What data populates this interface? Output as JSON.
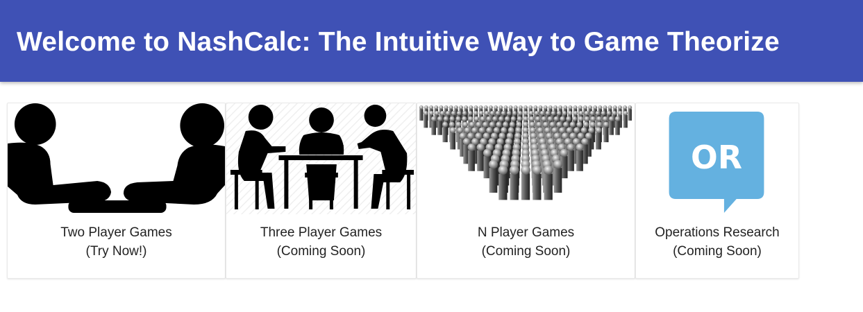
{
  "header": {
    "title": "Welcome to NashCalc: The Intuitive Way to Game Theorize",
    "background": "#3f51b5"
  },
  "cards": [
    {
      "icon": "two-players-icon",
      "line1": "Two Player Games",
      "line2": "(Try Now!)"
    },
    {
      "icon": "three-players-icon",
      "line1": "Three Player Games",
      "line2": "(Coming Soon)"
    },
    {
      "icon": "crowd-icon",
      "line1": "N Player Games",
      "line2": "(Coming Soon)"
    },
    {
      "icon": "or-speech-bubble-icon",
      "line1": "Operations Research",
      "line2": "(Coming Soon)",
      "badge_text": "OR",
      "accent": "#64b1e0"
    }
  ]
}
